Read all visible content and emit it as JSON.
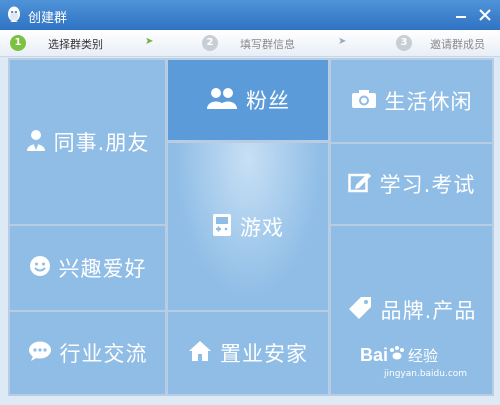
{
  "window": {
    "title": "创建群",
    "icon": "qq-penguin-icon",
    "minimize": "minimize-icon",
    "close": "close-icon"
  },
  "steps": [
    {
      "number": "1",
      "label": "选择群类别",
      "active": true
    },
    {
      "number": "2",
      "label": "填写群信息",
      "active": false
    },
    {
      "number": "3",
      "label": "邀请群成员",
      "active": false
    }
  ],
  "categories": {
    "colleagues": {
      "label": "同事.朋友",
      "icon": "user-icon"
    },
    "fans": {
      "label": "粉丝",
      "icon": "users-icon"
    },
    "life": {
      "label": "生活休闲",
      "icon": "camera-icon"
    },
    "games": {
      "label": "游戏",
      "icon": "gamepad-icon"
    },
    "study": {
      "label": "学习.考试",
      "icon": "edit-icon"
    },
    "hobbies": {
      "label": "兴趣爱好",
      "icon": "smiley-icon"
    },
    "brands": {
      "label": "品牌.产品",
      "icon": "tag-icon"
    },
    "industry": {
      "label": "行业交流",
      "icon": "chat-icon"
    },
    "realestate": {
      "label": "置业安家",
      "icon": "home-icon"
    }
  },
  "watermark": {
    "brand": "Bai",
    "brand2": "经验",
    "url": "jingyan.baidu.com"
  },
  "colors": {
    "tile_light": "#8fbde6",
    "tile_mid": "#7db2e2",
    "tile_dark": "#5b9bd9",
    "active_step": "#7cc242",
    "inactive_step": "#c8ced6",
    "titlebar": "#3b80cc"
  }
}
